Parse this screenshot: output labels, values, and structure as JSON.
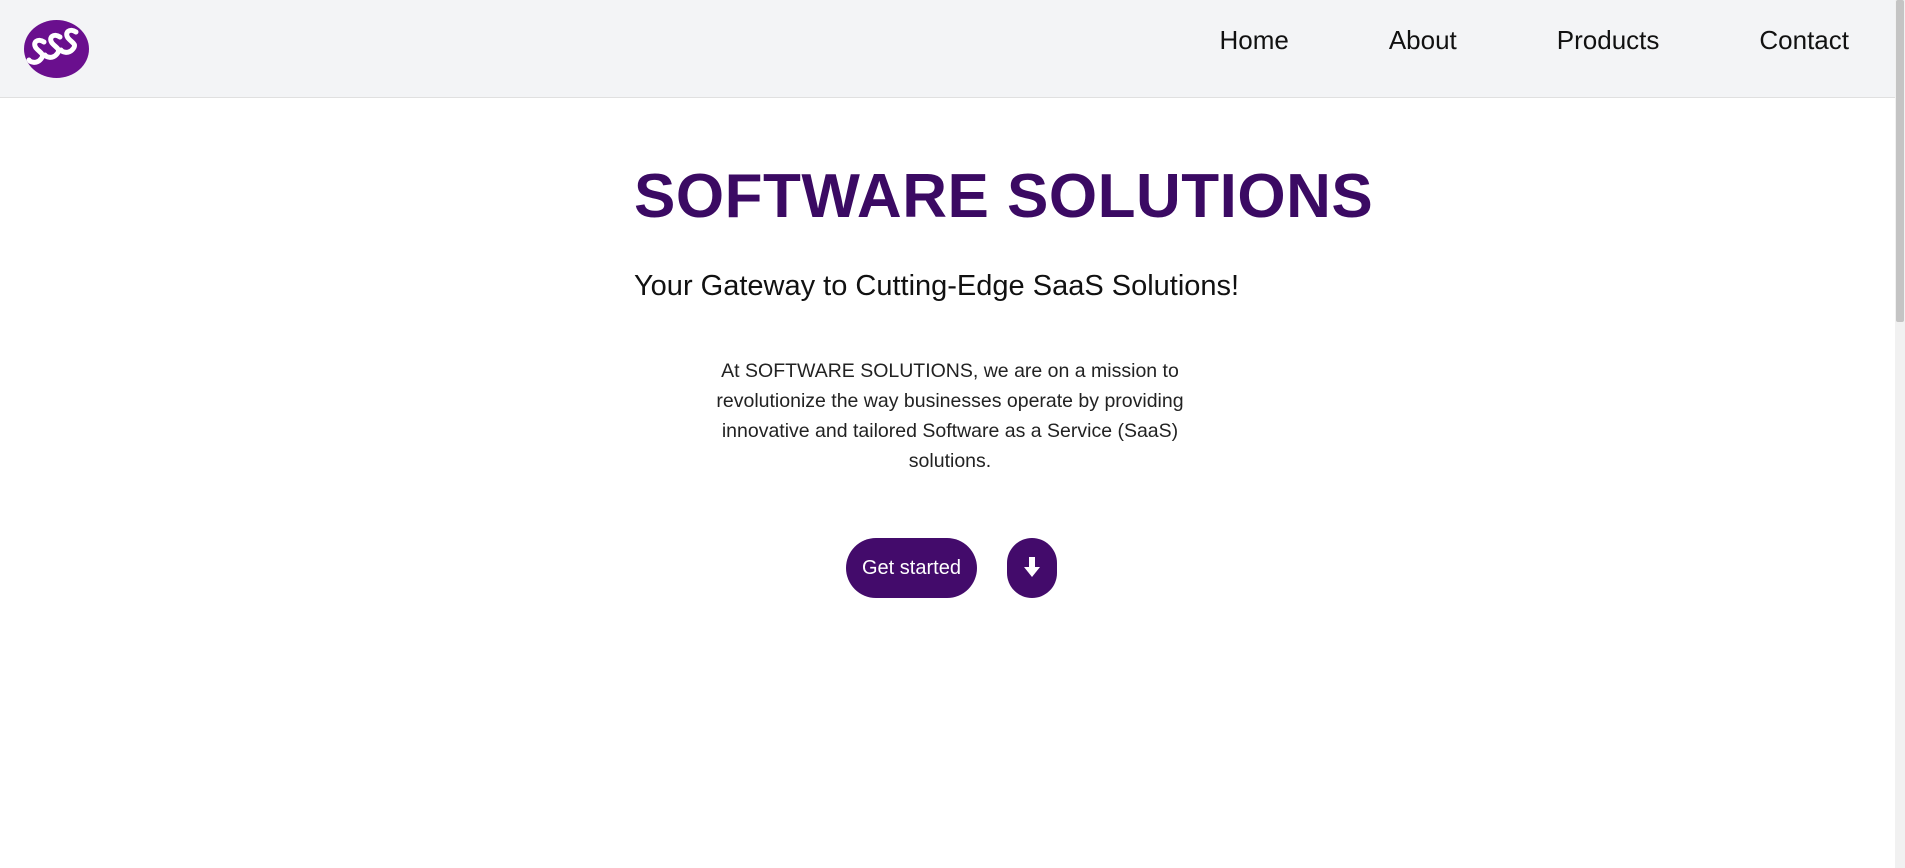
{
  "header": {
    "logo_text": "SSS",
    "nav": [
      {
        "label": "Home"
      },
      {
        "label": "About"
      },
      {
        "label": "Products"
      },
      {
        "label": "Contact"
      }
    ]
  },
  "hero": {
    "title": "SOFTWARE SOLUTIONS",
    "subtitle": "Your Gateway to Cutting-Edge SaaS Solutions!",
    "description": "At SOFTWARE SOLUTIONS, we are on a mission to revolutionize the way businesses operate by providing innovative and tailored Software as a Service (SaaS) solutions.",
    "cta_label": "Get started",
    "download_icon": "arrow-down-icon"
  },
  "colors": {
    "brand": "#3b0a63",
    "button": "#430b6b",
    "logo": "#6a0f8e",
    "header_bg": "#f3f4f6"
  }
}
